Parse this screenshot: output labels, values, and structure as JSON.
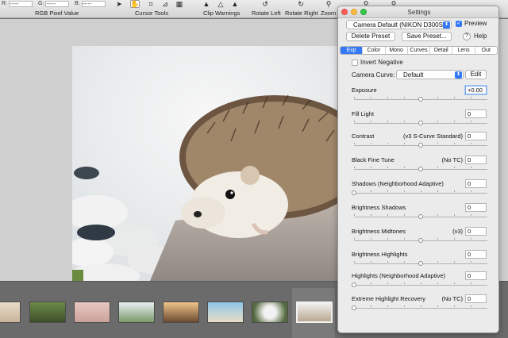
{
  "toolbar": {
    "r_label": "R:",
    "g_label": "G:",
    "b_label": "B:",
    "r_value": "-----",
    "g_value": "-----",
    "b_value": "-----",
    "rgb_label": "RGB Pixel Value",
    "cursor_tools_label": "Cursor Tools",
    "clip_warnings_label": "Clip Warnings",
    "rotate_left_label": "Rotate Left",
    "rotate_right_label": "Rotate Right",
    "zoom_label": "Zoom"
  },
  "settings": {
    "title": "Settings",
    "preset_select": "Camera Default (NIKON D300S)",
    "preview_label": "Preview",
    "preview_checked": true,
    "delete_preset": "Delete Preset",
    "save_preset": "Save Preset...",
    "help_icon": "?",
    "help_label": "Help",
    "tabs": [
      "Exp",
      "Color",
      "Mono",
      "Curves",
      "Detail",
      "Lens",
      "Out"
    ],
    "active_tab": "Exp",
    "invert_negative_label": "Invert Negative",
    "camera_curve_label": "Camera Curve:",
    "camera_curve_value": "Default",
    "edit_button": "Edit",
    "params": [
      {
        "label": "Exposure",
        "extra": "",
        "value": "+0.00",
        "level": 0.5
      },
      {
        "label": "Fill Light",
        "extra": "",
        "value": "0",
        "level": 0.5
      },
      {
        "label": "Contrast",
        "extra": "(v3 S-Curve Standard)",
        "value": "0",
        "level": 0.5
      },
      {
        "label": "Black Fine Tune",
        "extra": "(No TC)",
        "value": "0",
        "level": 0.5
      },
      {
        "label": "Shadows (Neighborhood Adaptive)",
        "extra": "",
        "value": "0",
        "level": 0.0
      },
      {
        "label": "Brightness Shadows",
        "extra": "",
        "value": "0",
        "level": 0.5
      },
      {
        "label": "Brightness Midtones",
        "extra": "(v3)",
        "value": "0",
        "level": 0.5
      },
      {
        "label": "Brightness Highlights",
        "extra": "",
        "value": "0",
        "level": 0.5
      },
      {
        "label": "Highlights (Neighborhood Adaptive)",
        "extra": "",
        "value": "0",
        "level": 0.0
      },
      {
        "label": "Extreme Highlight Recovery",
        "extra": "(No TC)",
        "value": "0",
        "level": 0.0
      }
    ]
  },
  "icons": [
    "arrow-cursor-icon",
    "hand-cursor-icon",
    "crop-icon",
    "grid-icon",
    "clip-warning-icon",
    "rotate-left-icon",
    "rotate-right-icon",
    "zoom-icon"
  ],
  "colors": {
    "accent": "#3478f6",
    "close": "#fc605c",
    "minimize": "#fdbc40",
    "maximize": "#34c84a"
  }
}
